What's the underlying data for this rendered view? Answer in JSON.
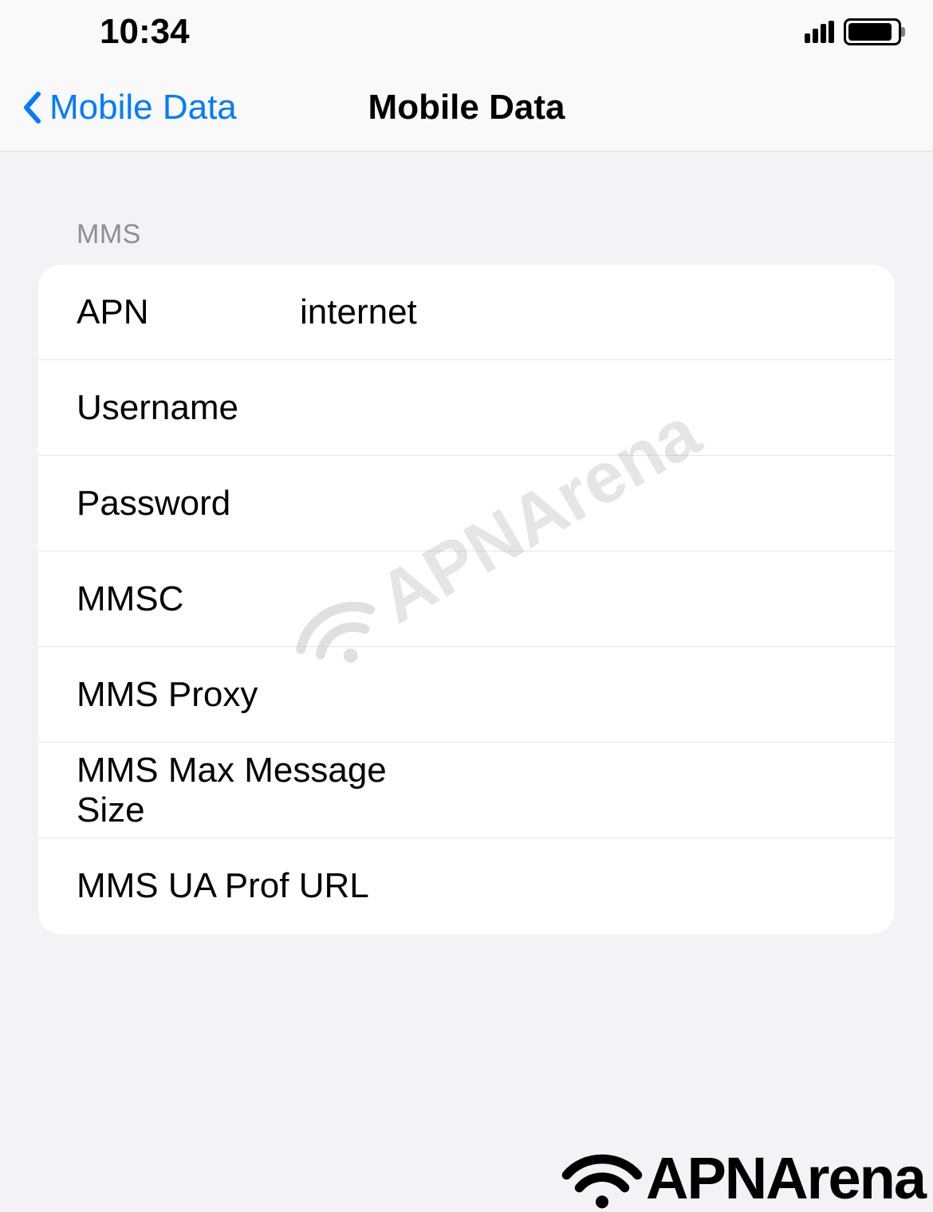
{
  "statusBar": {
    "time": "10:34"
  },
  "navBar": {
    "backLabel": "Mobile Data",
    "title": "Mobile Data"
  },
  "section": {
    "header": "MMS",
    "rows": [
      {
        "label": "APN",
        "value": "internet"
      },
      {
        "label": "Username",
        "value": ""
      },
      {
        "label": "Password",
        "value": ""
      },
      {
        "label": "MMSC",
        "value": ""
      },
      {
        "label": "MMS Proxy",
        "value": ""
      },
      {
        "label": "MMS Max Message Size",
        "value": ""
      },
      {
        "label": "MMS UA Prof URL",
        "value": ""
      }
    ]
  },
  "watermark": "APNArena",
  "branding": "APNArena"
}
